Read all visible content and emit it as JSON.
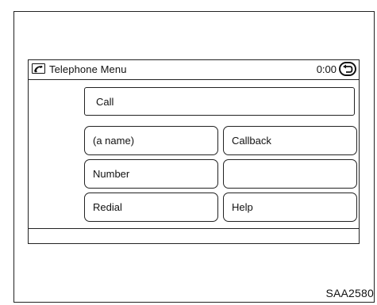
{
  "header": {
    "title": "Telephone Menu",
    "time": "0:00",
    "phone_icon": "phone-icon",
    "back_icon": "back-icon"
  },
  "menu": {
    "call_label": "Call",
    "items": [
      {
        "label": "(a name)"
      },
      {
        "label": "Callback"
      },
      {
        "label": "Number"
      },
      {
        "label": ""
      },
      {
        "label": "Redial"
      },
      {
        "label": "Help"
      }
    ]
  },
  "figure_code": "SAA2580"
}
